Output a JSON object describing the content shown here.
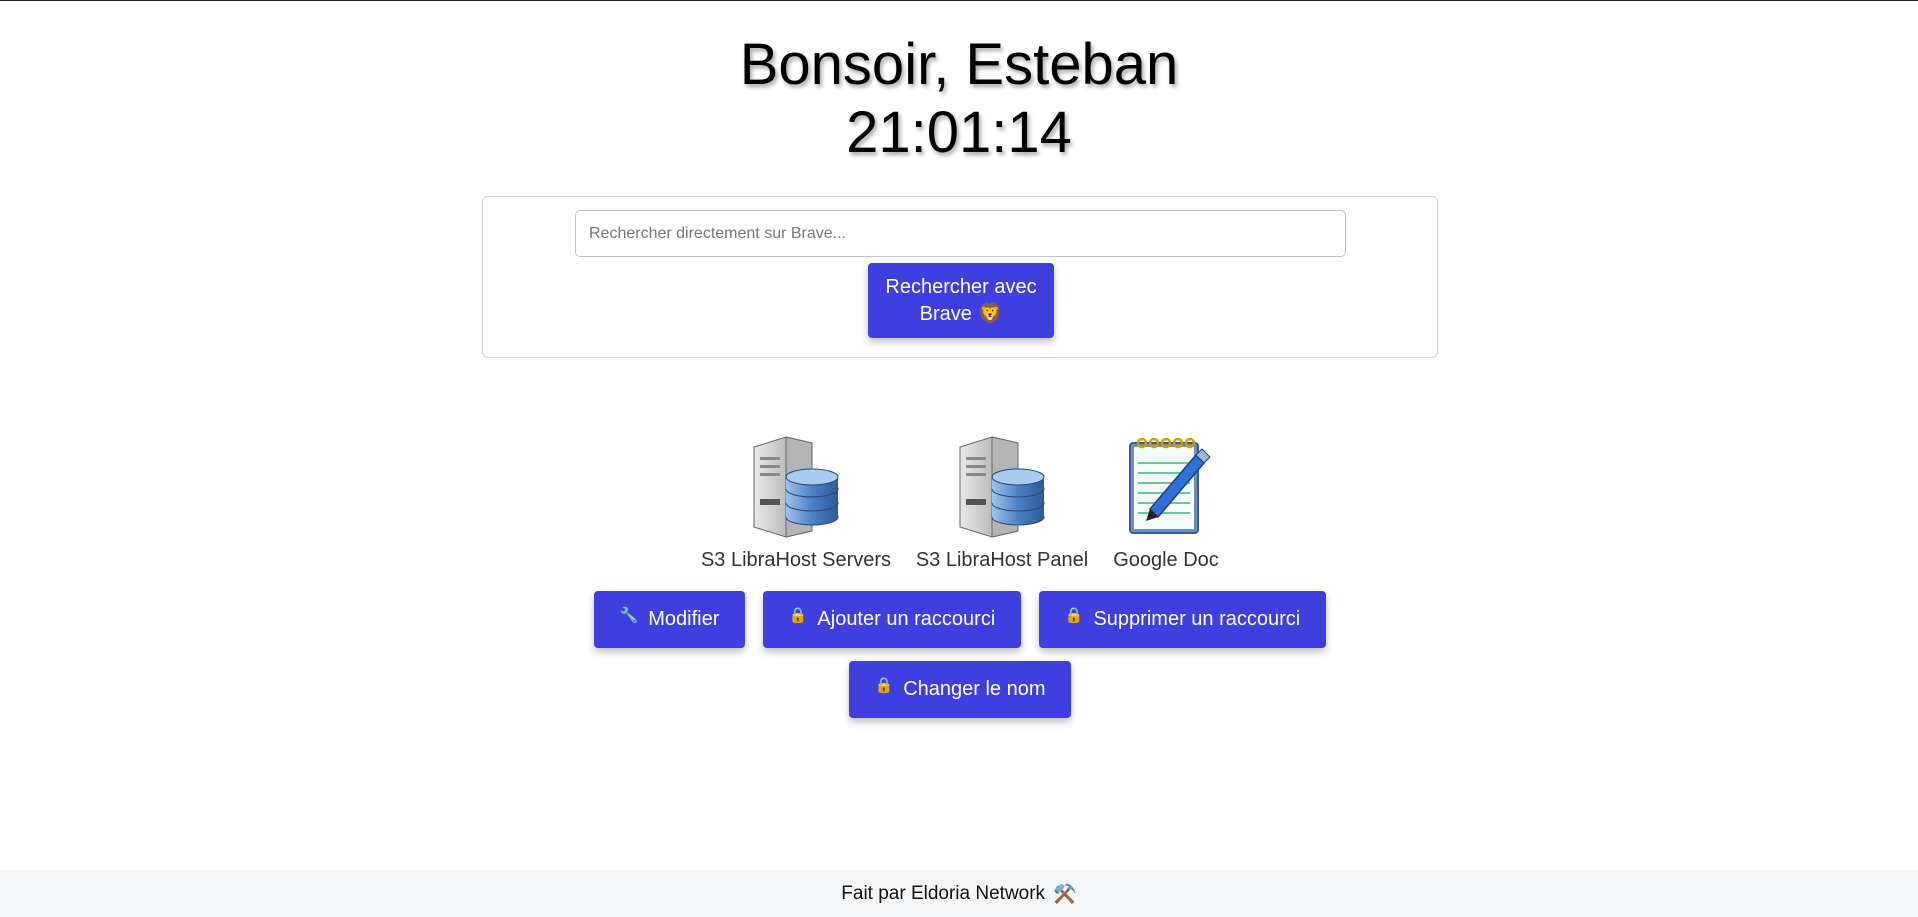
{
  "header": {
    "greeting": "Bonsoir, Esteban",
    "time": "21:01:14"
  },
  "search": {
    "placeholder": "Rechercher directement sur Brave...",
    "value": "",
    "button_label": "Rechercher avec Brave 🦁"
  },
  "shortcuts": [
    {
      "label": "S3 LibraHost Servers",
      "icon": "server-database-icon"
    },
    {
      "label": "S3 LibraHost Panel",
      "icon": "server-database-icon"
    },
    {
      "label": "Google Doc",
      "icon": "notepad-pen-icon"
    }
  ],
  "actions": {
    "modify": {
      "label": "Modifier",
      "icon": "🔧"
    },
    "add": {
      "label": "Ajouter un raccourci",
      "icon": "🔒"
    },
    "remove": {
      "label": "Supprimer un raccourci",
      "icon": "🔒"
    },
    "rename": {
      "label": "Changer le nom",
      "icon": "🔒"
    }
  },
  "footer": {
    "text": "Fait par Eldoria Network",
    "icon": "⚒️"
  },
  "colors": {
    "accent": "#3f3fe0",
    "footer_bg": "#f5f6f8"
  }
}
